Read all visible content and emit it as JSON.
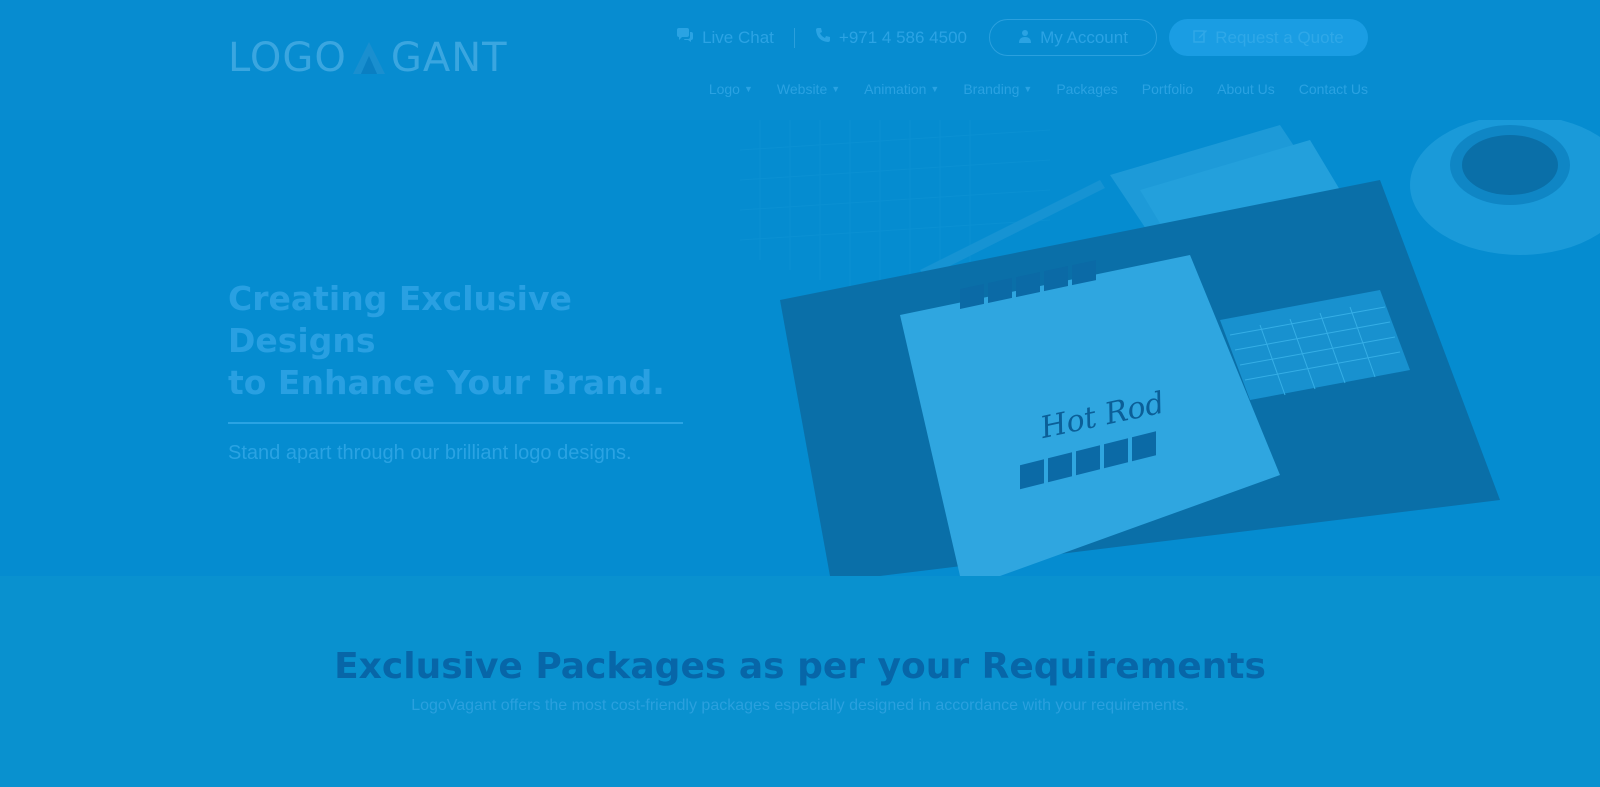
{
  "header": {
    "logo_left": "LOGO",
    "logo_right": "GANT",
    "live_chat": "Live Chat",
    "phone": "+971 4 586 4500",
    "my_account": "My Account",
    "request_quote": "Request a Quote",
    "nav": [
      {
        "label": "Logo",
        "dropdown": true
      },
      {
        "label": "Website",
        "dropdown": true
      },
      {
        "label": "Animation",
        "dropdown": true
      },
      {
        "label": "Branding",
        "dropdown": true
      },
      {
        "label": "Packages",
        "dropdown": false
      },
      {
        "label": "Portfolio",
        "dropdown": false
      },
      {
        "label": "About Us",
        "dropdown": false
      },
      {
        "label": "Contact Us",
        "dropdown": false
      }
    ]
  },
  "hero": {
    "title_line1": "Creating Exclusive Designs",
    "title_line2": "to Enhance Your Brand.",
    "subtitle": "Stand apart through our brilliant logo designs.",
    "artwork_text": "Hot Rod"
  },
  "packages": {
    "title": "Exclusive Packages as per your Requirements",
    "subtitle": "LogoVagant offers the most cost-friendly packages especially designed in accordance with your requirements."
  },
  "icons": {
    "chat": "chat-icon",
    "phone": "phone-icon",
    "user": "user-icon",
    "edit": "edit-icon",
    "chevron": "chevron-down-icon"
  },
  "colors": {
    "overlay": "#078cd0",
    "title_dark": "#0766a8",
    "text_light": "#2aa3e3"
  }
}
